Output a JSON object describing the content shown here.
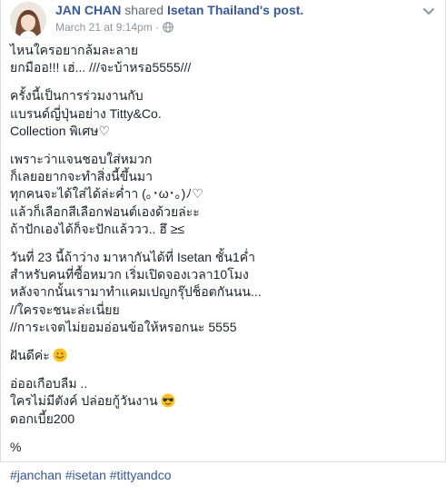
{
  "post": {
    "author": "JAN CHAN",
    "action": "shared",
    "shared_from": "Isetan Thailand's",
    "shared_object": "post.",
    "timestamp": "March 21 at 9:14pm",
    "separator": "·"
  },
  "icons": {
    "avatar": "profile-photo",
    "privacy": "globe-icon",
    "more": "chevron-down-icon",
    "emoji_smile": "smile-emoji",
    "emoji_cool": "sunglasses-emoji"
  },
  "content": {
    "p1": [
      "ไหนใครอยากล้มละลาย",
      "ยกมืออ!!! เฮ่... ///จะบ้าหรอ5555///"
    ],
    "p2": [
      "ครั้งนี้เป็นการร่วมงานกับ",
      "แบรนด์ญี่ปุ่นอย่าง Titty&Co.",
      "Collection พิเศษ♡"
    ],
    "p3": [
      "เพราะว่าแจนชอบใส่หมวก",
      "ก็เลยอยากจะทำสิ่งนี้ขึ้นมา",
      "ทุกคนจะได้ใส่ได้ล่ะค่ำา (｡･ω･｡)ﾉ♡",
      "แล้วก็เลือกสีเลือกฟอนต์เองด้วยล่ะะ",
      "ถ้าปักเองได้ก็จะปักแล้ววว.. ฮึ ≥≤"
    ],
    "p4": [
      "วันที่ 23 นี้ถ้าว่าง มาหากันได้ที่ Isetan ชั้น1ค่ำ",
      "สำหรับคนที่ซื้อหมวก เริ่มเปิดจองเวลา10โมง",
      "หลังจากนั้นเรามาทำแคมเปญกรุ๊ปช็อตกันนน...",
      "//ใครจะชนะล่ะเนี่ยย",
      "//การะเจตไม่ยอมอ่อนข้อให้หรอกนะ 5555"
    ],
    "p5": "ฝันดีค่ะ",
    "p6": [
      "อ่ออเกือบลืม ..",
      "ใครไม่มีตังค์ ปล่อยกู้วันงาน",
      "ดอกเบี้ย200"
    ],
    "p7": "%",
    "hashtags": [
      "#janchan",
      "#isetan",
      "#tittyandco"
    ]
  },
  "colors": {
    "link": "#385898",
    "meta": "#90949c",
    "text": "#1d2129",
    "hashtag": "#365899",
    "emoji_face": "#fcc21b"
  }
}
